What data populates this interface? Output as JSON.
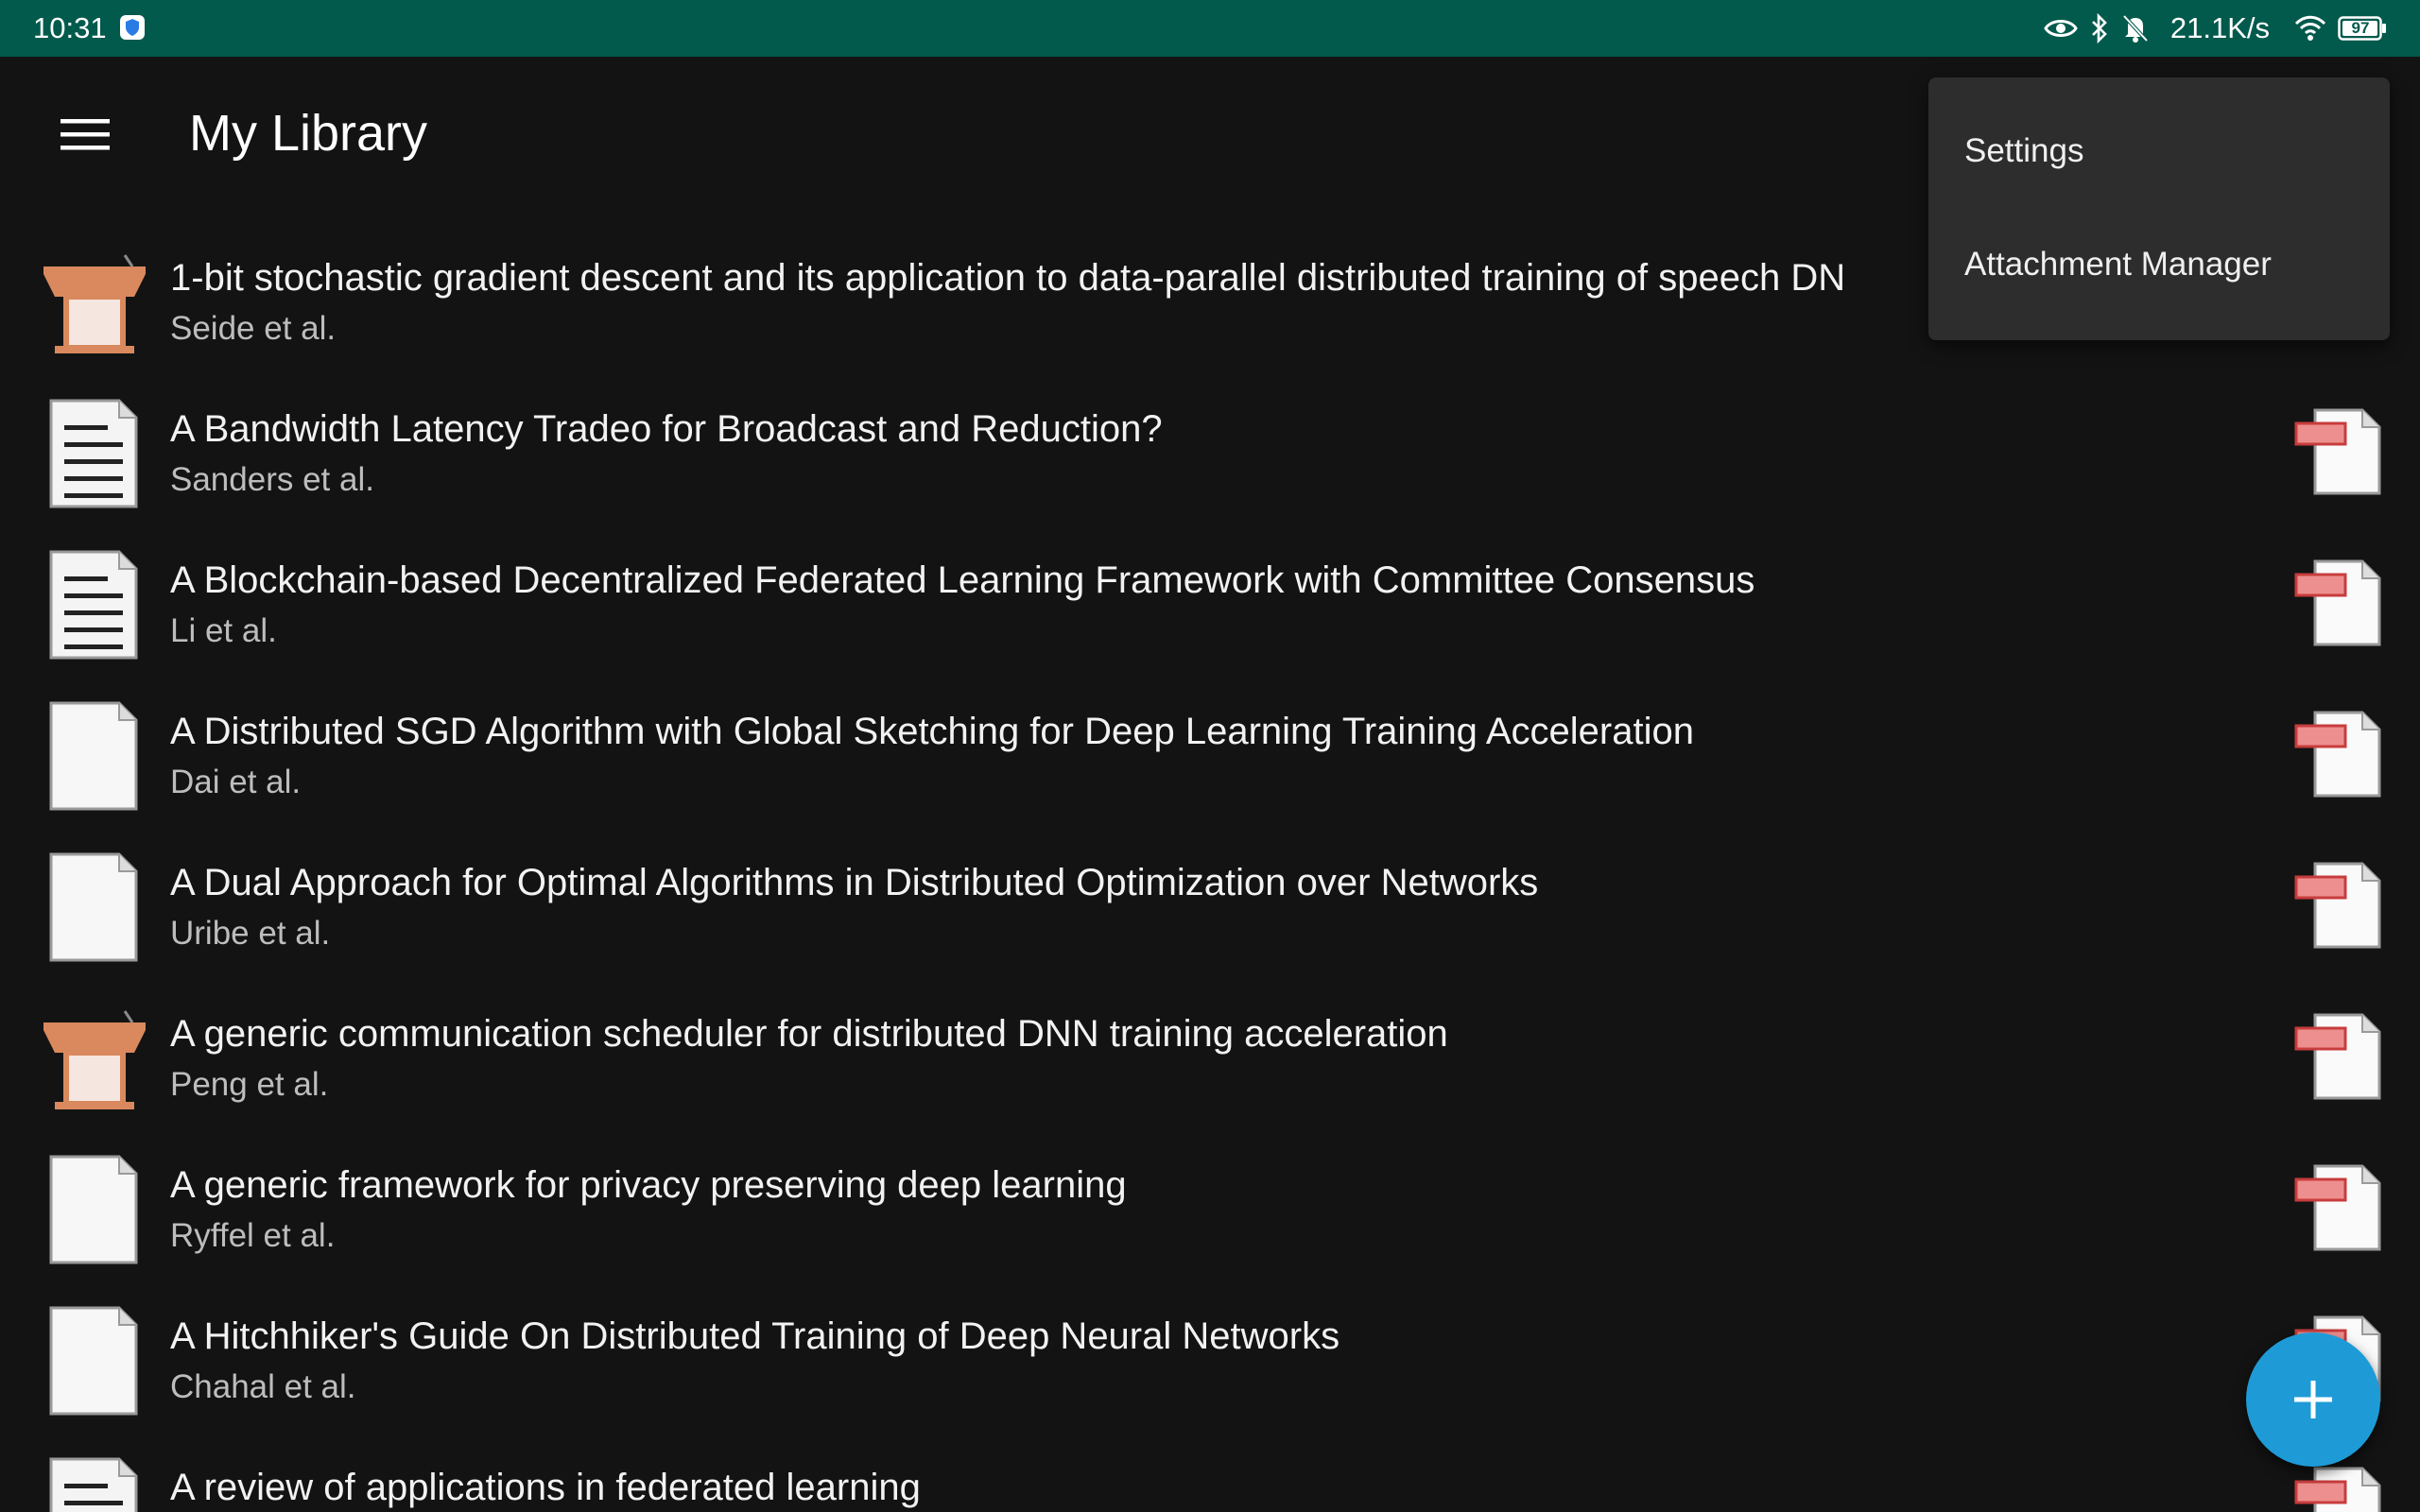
{
  "status_bar": {
    "time": "10:31",
    "network_speed": "21.1K/s",
    "battery": "97",
    "icons": [
      "shield-icon",
      "eye-icon",
      "bluetooth-icon",
      "bell-off-icon",
      "wifi-icon",
      "battery-icon"
    ]
  },
  "app_bar": {
    "menu_icon": "hamburger-menu-icon",
    "title": "My Library"
  },
  "items": [
    {
      "title": "1-bit stochastic gradient descent and its application to data-parallel distributed training of speech DN",
      "authors": "Seide et al.",
      "type": "conference-paper"
    },
    {
      "title": "A Bandwidth Latency Tradeo for Broadcast and Reduction?",
      "authors": "Sanders et al.",
      "type": "document"
    },
    {
      "title": "A Blockchain-based Decentralized Federated Learning Framework with Committee Consensus",
      "authors": "Li et al.",
      "type": "document"
    },
    {
      "title": "A Distributed SGD Algorithm with Global Sketching for Deep Learning Training Acceleration",
      "authors": "Dai et al.",
      "type": "preprint"
    },
    {
      "title": "A Dual Approach for Optimal Algorithms in Distributed Optimization over Networks",
      "authors": "Uribe et al.",
      "type": "preprint"
    },
    {
      "title": "A generic communication scheduler for distributed DNN training acceleration",
      "authors": "Peng et al.",
      "type": "conference-paper"
    },
    {
      "title": "A generic framework for privacy preserving deep learning",
      "authors": "Ryffel et al.",
      "type": "preprint"
    },
    {
      "title": "A Hitchhiker's Guide On Distributed Training of Deep Neural Networks",
      "authors": "Chahal et al.",
      "type": "preprint"
    },
    {
      "title": "A review of applications in federated learning",
      "authors": "",
      "type": "document"
    }
  ],
  "overflow_menu": {
    "items": [
      "Settings",
      "Attachment Manager"
    ]
  },
  "fab": {
    "icon": "plus-icon"
  },
  "colors": {
    "status_bar": "#025a4c",
    "background": "#131313",
    "menu_background": "#2d2d2d",
    "fab": "#1e9bd7",
    "pdf_badge": "#e57373"
  }
}
